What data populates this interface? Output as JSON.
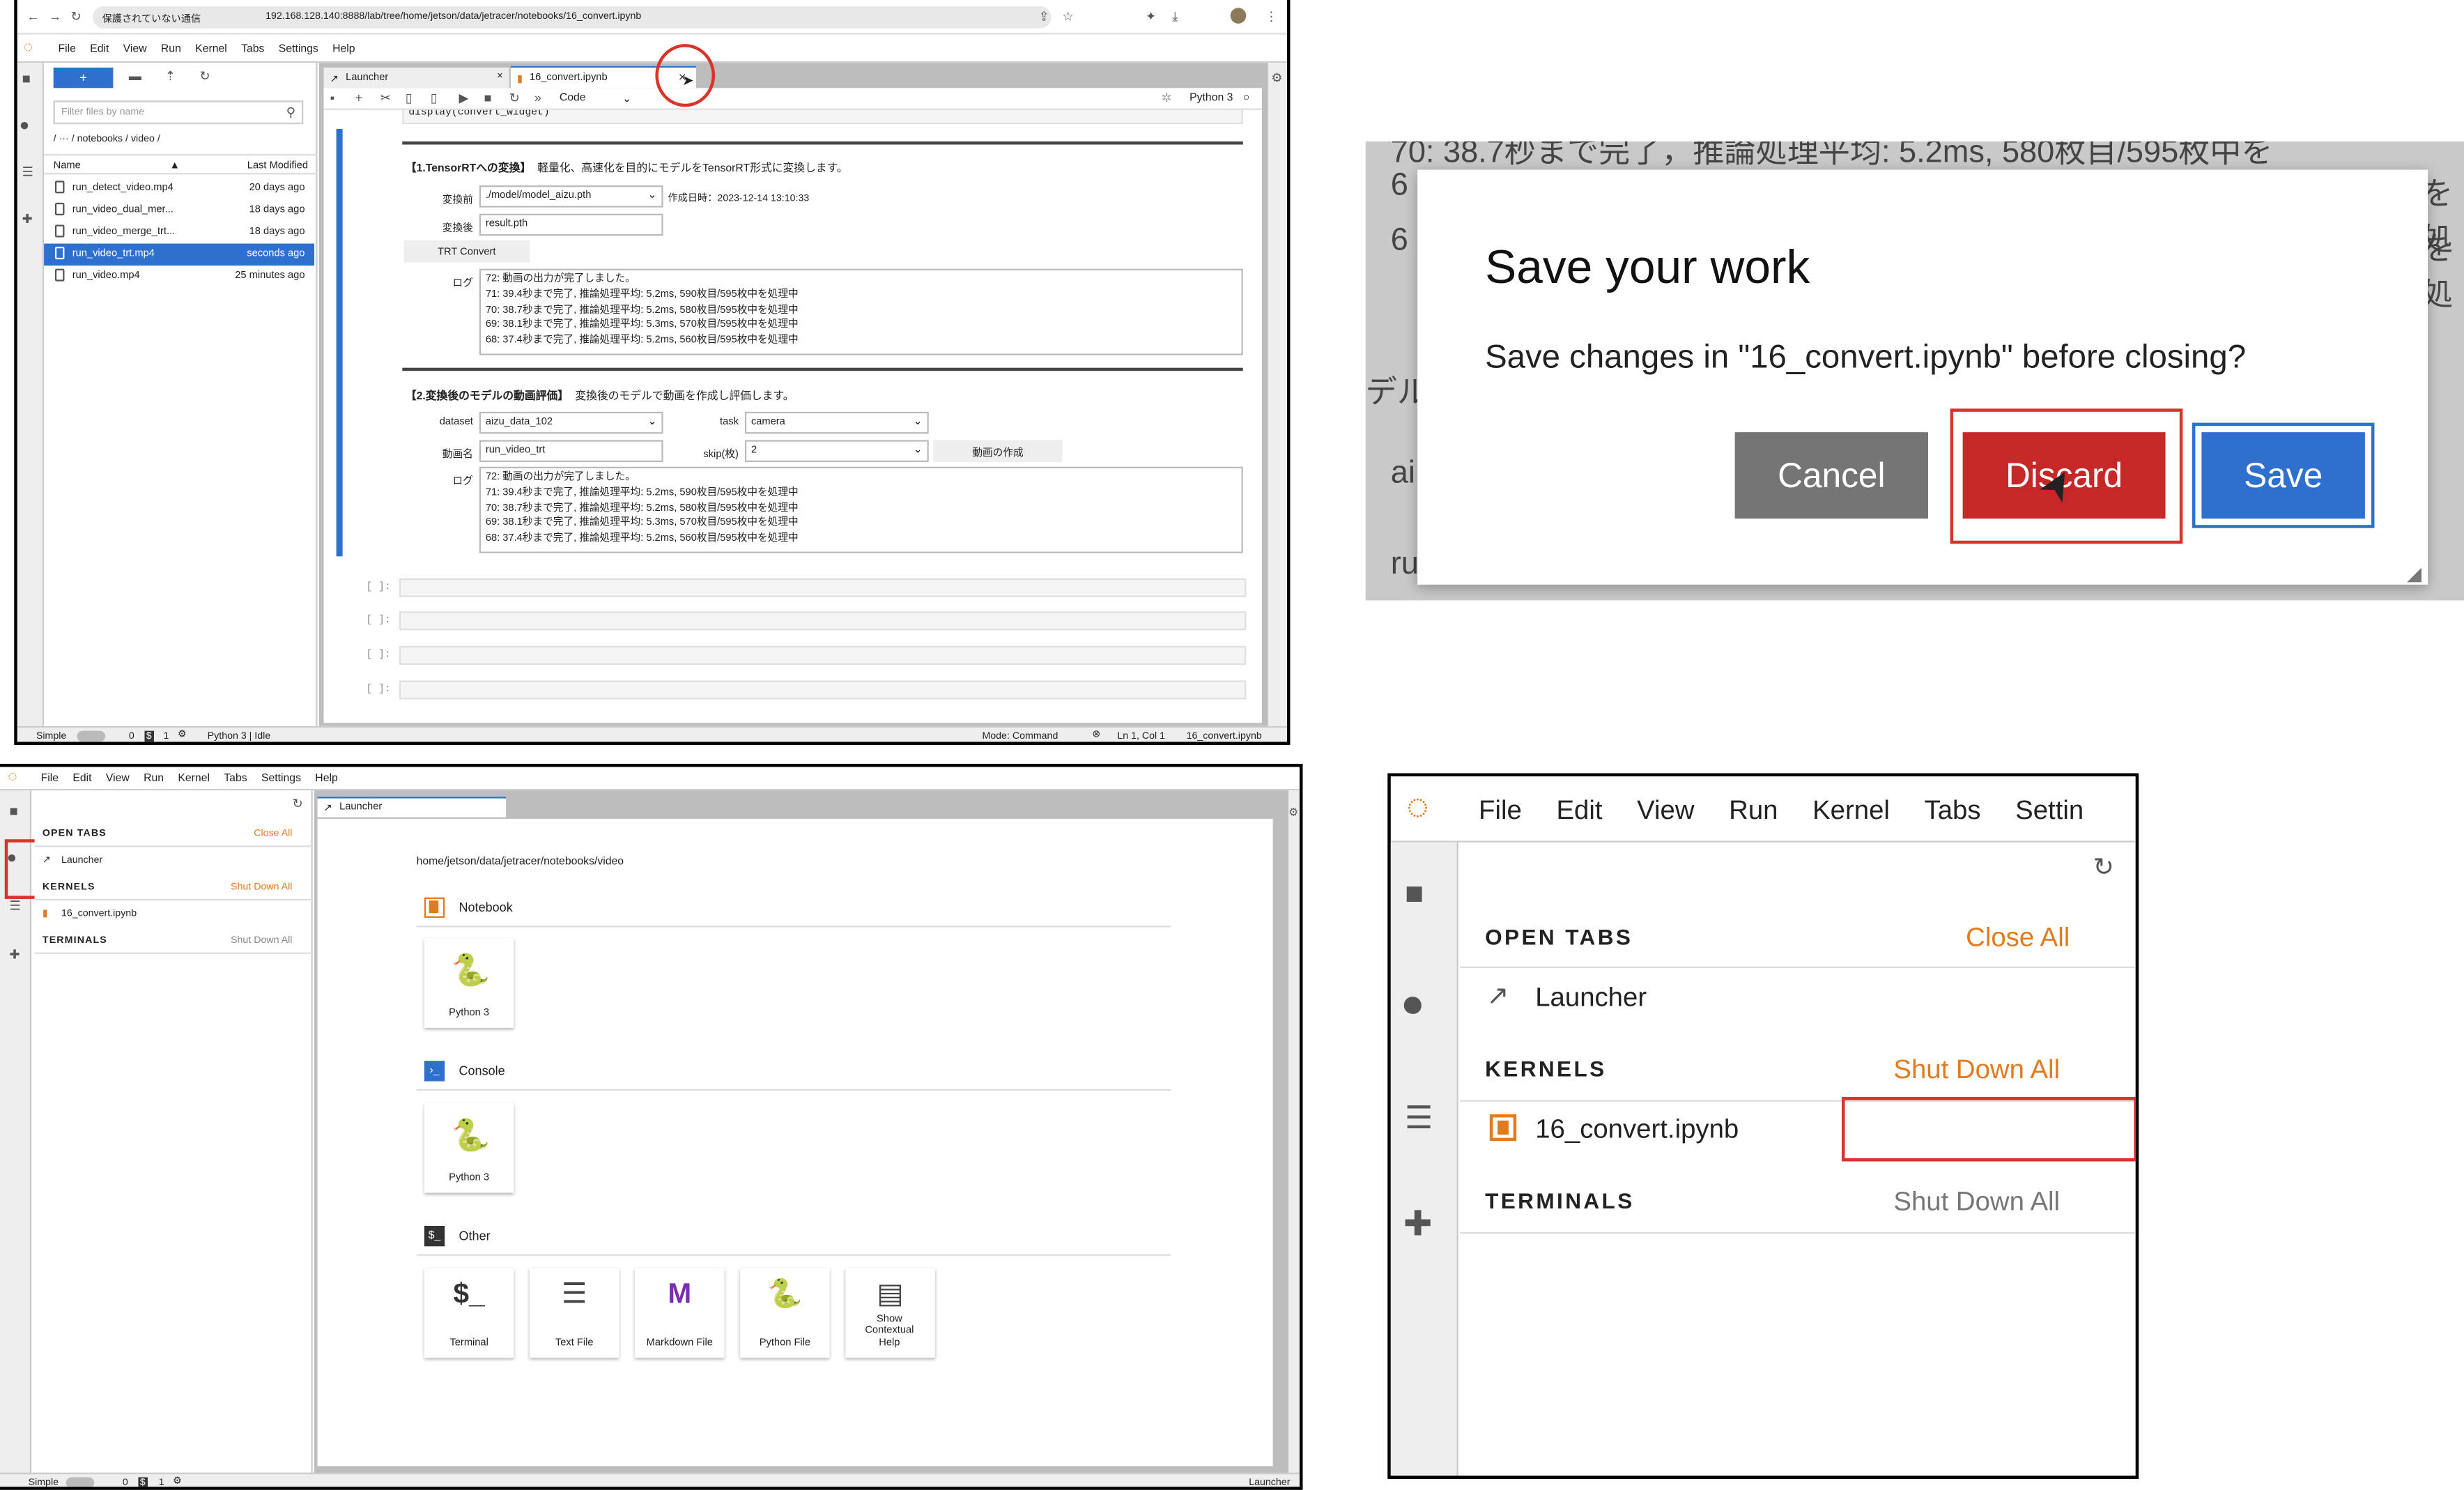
{
  "browser": {
    "security": "保護されていない通信",
    "url": "192.168.128.140:8888/lab/tree/home/jetson/data/jetracer/notebooks/16_convert.ipynb"
  },
  "menu": [
    "File",
    "Edit",
    "View",
    "Run",
    "Kernel",
    "Tabs",
    "Settings",
    "Help"
  ],
  "filebrowser": {
    "new_label": "+",
    "filter_placeholder": "Filter files by name",
    "breadcrumb": "/  ···  / notebooks / video /",
    "col_name": "Name",
    "col_modified": "Last Modified",
    "files": [
      {
        "name": "run_detect_video.mp4",
        "modified": "20 days ago"
      },
      {
        "name": "run_video_dual_mer...",
        "modified": "18 days ago"
      },
      {
        "name": "run_video_merge_trt...",
        "modified": "18 days ago"
      },
      {
        "name": "run_video_trt.mp4",
        "modified": "seconds ago",
        "selected": true
      },
      {
        "name": "run_video.mp4",
        "modified": "25 minutes ago"
      }
    ]
  },
  "tabs": [
    {
      "label": "Launcher"
    },
    {
      "label": "16_convert.ipynb",
      "active": true
    }
  ],
  "toolbar": {
    "cell_type": "Code",
    "kernel": "Python 3"
  },
  "notebook": {
    "code_partial": "display(convert_widget)",
    "s1_title": "【1.TensorRTへの変換】",
    "s1_desc": "軽量化、高速化を目的にモデルをTensorRT形式に変換します。",
    "before_label": "変換前",
    "before_value": "./model/model_aizu.pth",
    "created": "作成日時：2023-12-14 13:10:33",
    "after_label": "変換後",
    "after_value": "result.pth",
    "convert_button": "TRT Convert",
    "log_label": "ログ",
    "log": [
      "72: 動画の出力が完了しました。",
      "71: 39.4秒まで完了, 推論処理平均: 5.2ms, 590枚目/595枚中を処理中",
      "70: 38.7秒まで完了, 推論処理平均: 5.2ms, 580枚目/595枚中を処理中",
      "69: 38.1秒まで完了, 推論処理平均: 5.3ms, 570枚目/595枚中を処理中",
      "68: 37.4秒まで完了, 推論処理平均: 5.2ms, 560枚目/595枚中を処理中"
    ],
    "s2_title": "【2.変換後のモデルの動画評価】",
    "s2_desc": "変換後のモデルで動画を作成し評価します。",
    "dataset_label": "dataset",
    "dataset_value": "aizu_data_102",
    "task_label": "task",
    "task_value": "camera",
    "video_label": "動画名",
    "video_value": "run_video_trt",
    "skip_label": "skip(枚)",
    "skip_value": "2",
    "make_button": "動画の作成",
    "empty_prompt": "[ ]:"
  },
  "status_top": {
    "simple": "Simple",
    "terminals": "0",
    "kernels": "1",
    "kernel_status": "Python 3 | Idle",
    "mode": "Mode: Command",
    "position": "Ln 1, Col 1",
    "file": "16_convert.ipynb"
  },
  "dialog": {
    "bg_text": [
      "70: 38.7秒まで完了，推論処理平均: 5.2ms, 580枚目/595枚中を",
      "6",
      "6",
      "デル",
      "ai",
      "ru",
      "を処",
      "を処"
    ],
    "title": "Save your work",
    "message": "Save changes in \"16_convert.ipynb\" before closing?",
    "cancel": "Cancel",
    "discard": "Discard",
    "save": "Save"
  },
  "running": {
    "open_tabs": "OPEN TABS",
    "close_all": "Close All",
    "launcher": "Launcher",
    "kernels": "KERNELS",
    "shut_down_all": "Shut Down All",
    "kernel_item": "16_convert.ipynb",
    "terminals": "TERMINALS",
    "terminals_shutdown": "Shut Down All"
  },
  "launcher": {
    "tab": "Launcher",
    "path": "home/jetson/data/jetracer/notebooks/video",
    "notebook": "Notebook",
    "console": "Console",
    "other": "Other",
    "python": "Python 3",
    "other_items": [
      "Terminal",
      "Text File",
      "Markdown File",
      "Python File",
      "Show Contextual Help"
    ]
  },
  "status_bottom": {
    "simple": "Simple",
    "terminals": "0",
    "kernels": "1",
    "right": "Launcher"
  },
  "zoom_menu": [
    "File",
    "Edit",
    "View",
    "Run",
    "Kernel",
    "Tabs",
    "Settin"
  ],
  "colors": {
    "accent": "#2f6fce",
    "orange": "#e07b20",
    "highlight": "#d8342a",
    "discard": "#c62828",
    "cancel": "#757575"
  }
}
